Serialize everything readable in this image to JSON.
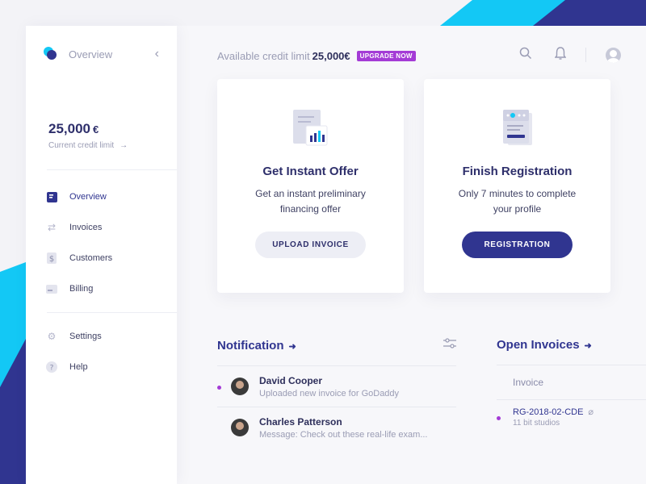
{
  "sidebar": {
    "brand": "Overview",
    "credit_amount": "25,000",
    "credit_currency": "€",
    "credit_label": "Current credit limit",
    "nav": [
      {
        "label": "Overview",
        "icon": "document-icon",
        "active": true
      },
      {
        "label": "Invoices",
        "icon": "swap-arrows-icon"
      },
      {
        "label": "Customers",
        "icon": "dollar-icon"
      },
      {
        "label": "Billing",
        "icon": "card-icon"
      }
    ],
    "nav_bottom": [
      {
        "label": "Settings",
        "icon": "gear-icon"
      },
      {
        "label": "Help",
        "icon": "help-icon"
      }
    ]
  },
  "topbar": {
    "available_label": "Available credit limit",
    "available_amount": "25,000€",
    "upgrade_label": "UPGRADE NOW"
  },
  "cards": [
    {
      "title": "Get Instant Offer",
      "text": "Get an instant preliminary financing offer",
      "button": "UPLOAD INVOICE"
    },
    {
      "title": "Finish Registration",
      "text": "Only 7 minutes to complete your profile",
      "button": "REGISTRATION"
    }
  ],
  "notifications": {
    "title": "Notification",
    "items": [
      {
        "name": "David Cooper",
        "message": "Uploaded new invoice for GoDaddy",
        "unread": true
      },
      {
        "name": "Charles Patterson",
        "message": "Message: Check out these real-life exam...",
        "unread": false
      }
    ]
  },
  "open_invoices": {
    "title": "Open Invoices",
    "column": "Invoice",
    "rows": [
      {
        "id": "RG-2018-02-CDE",
        "company": "11 bit studios",
        "unread": true
      }
    ]
  },
  "colors": {
    "accent_navy": "#303590",
    "accent_cyan": "#13c8f5",
    "badge_purple": "#a43bd6"
  }
}
